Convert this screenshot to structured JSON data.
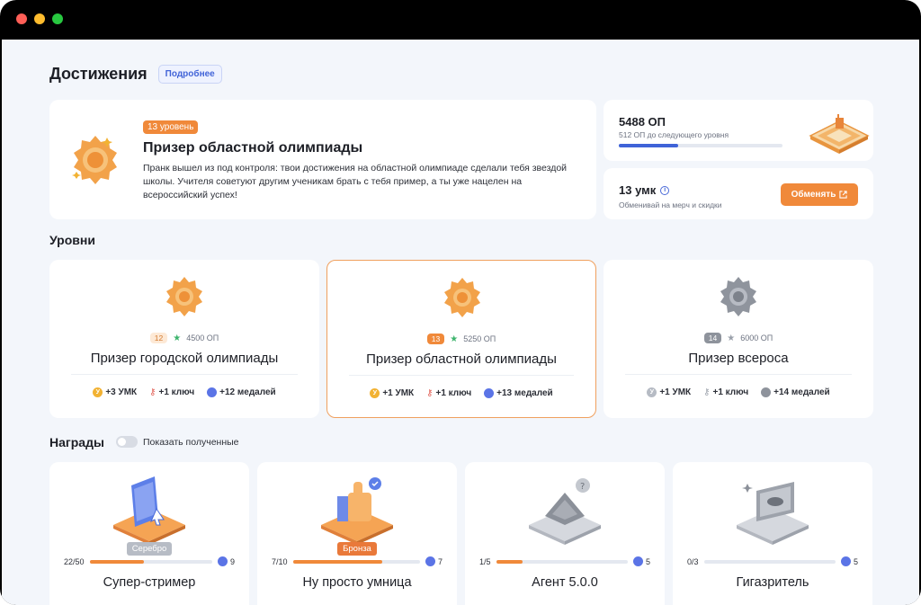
{
  "page": {
    "title": "Достижения",
    "more_label": "Подробнее"
  },
  "hero": {
    "level_label": "13 уровень",
    "title": "Призер областной олимпиады",
    "description": "Пранк вышел из под контроля: твои достижения на областной олимпиаде сделали тебя звездой школы. Учителя советуют другим ученикам брать с тебя пример, а ты уже нацелен на всероссийский успех!"
  },
  "points": {
    "value": "5488 ОП",
    "subtitle": "512 ОП до следующего уровня",
    "progress_fraction": 0.36
  },
  "umk": {
    "value": "13 умк",
    "subtitle": "Обменивай на мерч и скидки",
    "exchange_label": "Обменять"
  },
  "levels_section": {
    "title": "Уровни"
  },
  "levels": [
    {
      "num": "12",
      "points": "4500 ОП",
      "title": "Призер городской олимпиады",
      "umk": "+3 УМК",
      "keys": "+1 ключ",
      "medals": "+12 медалей",
      "state": "done"
    },
    {
      "num": "13",
      "points": "5250 ОП",
      "title": "Призер областной олимпиады",
      "umk": "+1 УМК",
      "keys": "+1 ключ",
      "medals": "+13 медалей",
      "state": "current"
    },
    {
      "num": "14",
      "points": "6000 ОП",
      "title": "Призер всероса",
      "umk": "+1 УМК",
      "keys": "+1 ключ",
      "medals": "+14 медалей",
      "state": "locked"
    }
  ],
  "awards_section": {
    "title": "Награды",
    "toggle_label": "Показать полученные"
  },
  "awards": [
    {
      "title": "Супер-стример",
      "badge": "Серебро",
      "progress_text": "22/50",
      "progress_fraction": 0.44,
      "reward": "9"
    },
    {
      "title": "Ну просто умница",
      "badge": "Бронза",
      "progress_text": "7/10",
      "progress_fraction": 0.7,
      "reward": "7"
    },
    {
      "title": "Агент 5.0.0",
      "badge": "",
      "progress_text": "1/5",
      "progress_fraction": 0.2,
      "reward": "5"
    },
    {
      "title": "Гигазритель",
      "badge": "",
      "progress_text": "0/3",
      "progress_fraction": 0.0,
      "reward": "5"
    }
  ],
  "colors": {
    "accent": "#f0893a",
    "progress_blue": "#3f63d8",
    "background": "#f3f6fb"
  }
}
